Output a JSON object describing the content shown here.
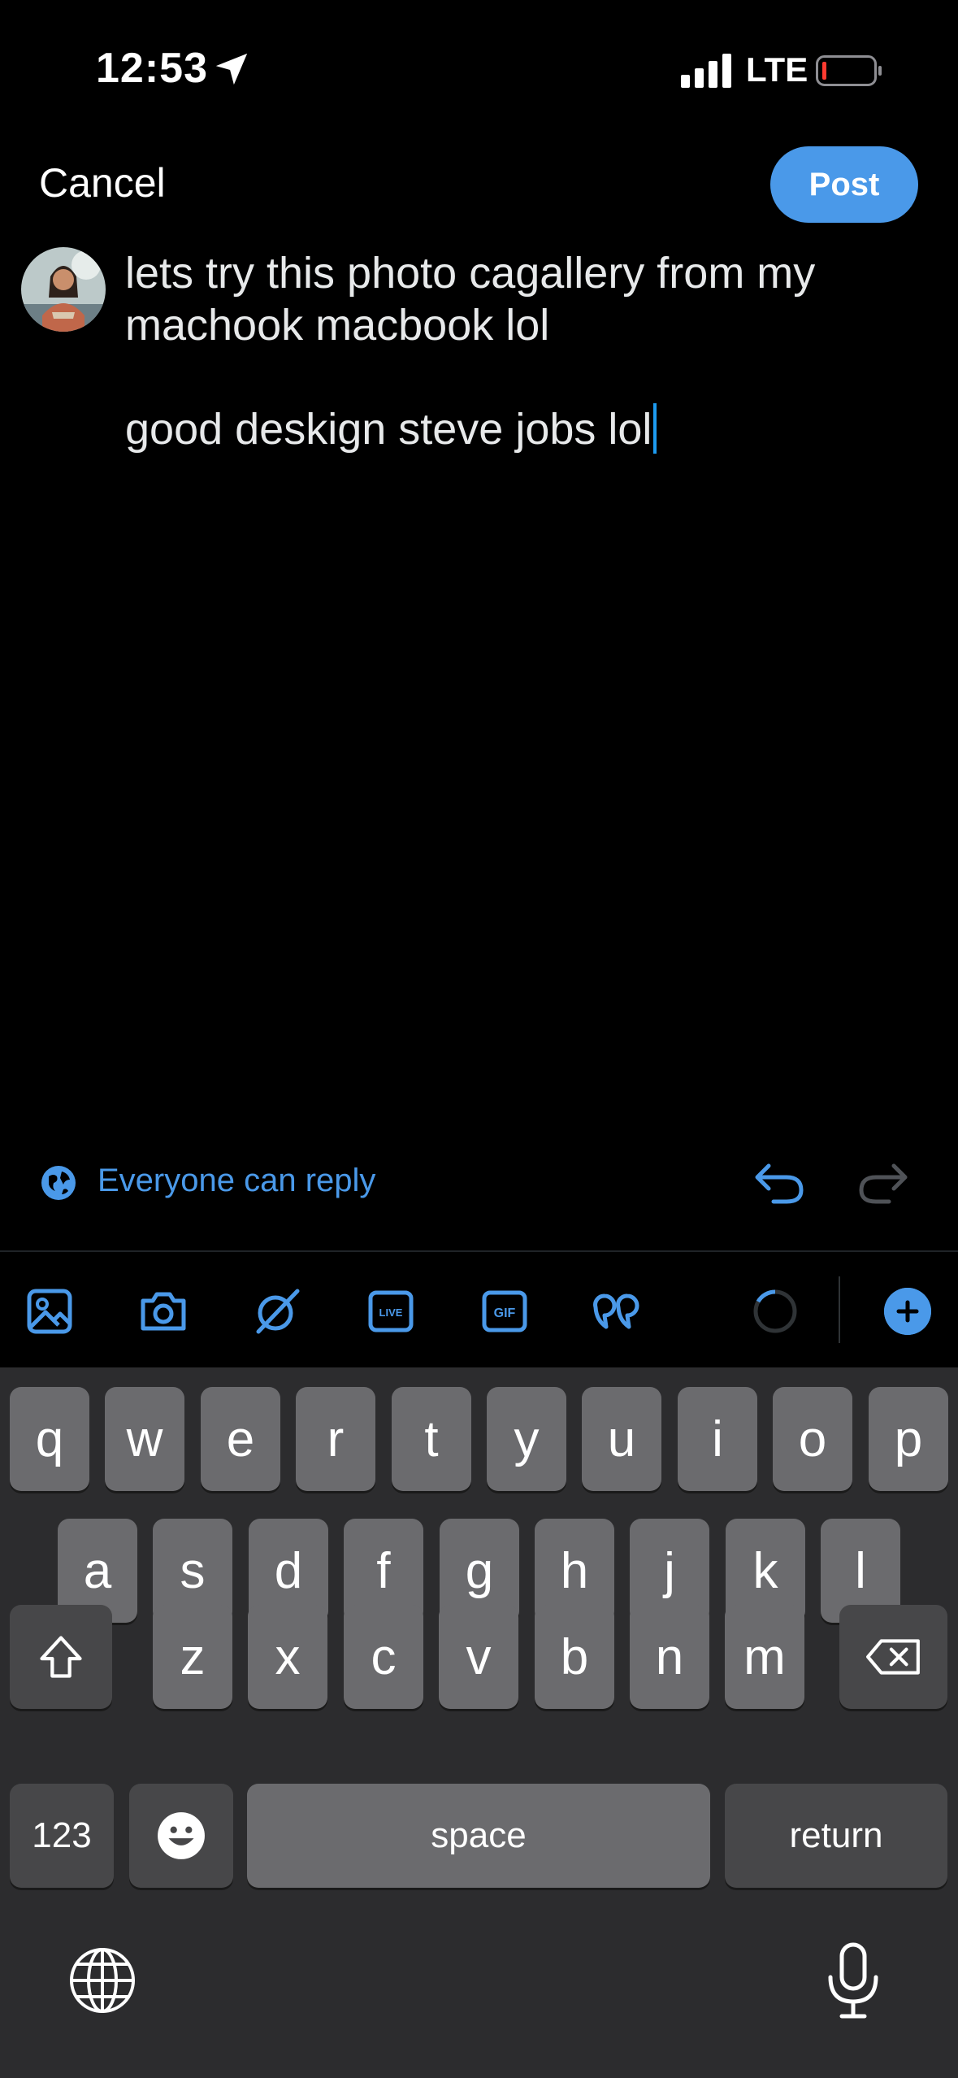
{
  "status_bar": {
    "time": "12:53",
    "network": "LTE"
  },
  "header": {
    "cancel_label": "Cancel",
    "post_label": "Post"
  },
  "compose": {
    "line1": "lets try this photo cagallery from my machook macbook lol",
    "line2": "good deskign steve jobs lol"
  },
  "reply_setting": {
    "label": "Everyone can reply"
  },
  "toolbar": {
    "live_label": "LIVE",
    "gif_label": "GIF"
  },
  "keyboard": {
    "row1": [
      "q",
      "w",
      "e",
      "r",
      "t",
      "y",
      "u",
      "i",
      "o",
      "p"
    ],
    "row2": [
      "a",
      "s",
      "d",
      "f",
      "g",
      "h",
      "j",
      "k",
      "l"
    ],
    "row3": [
      "z",
      "x",
      "c",
      "v",
      "b",
      "n",
      "m"
    ],
    "numbers_label": "123",
    "space_label": "space",
    "return_label": "return"
  },
  "colors": {
    "accent": "#4a99e9",
    "background": "#000000",
    "keyboard_bg": "#2c2c2e"
  }
}
